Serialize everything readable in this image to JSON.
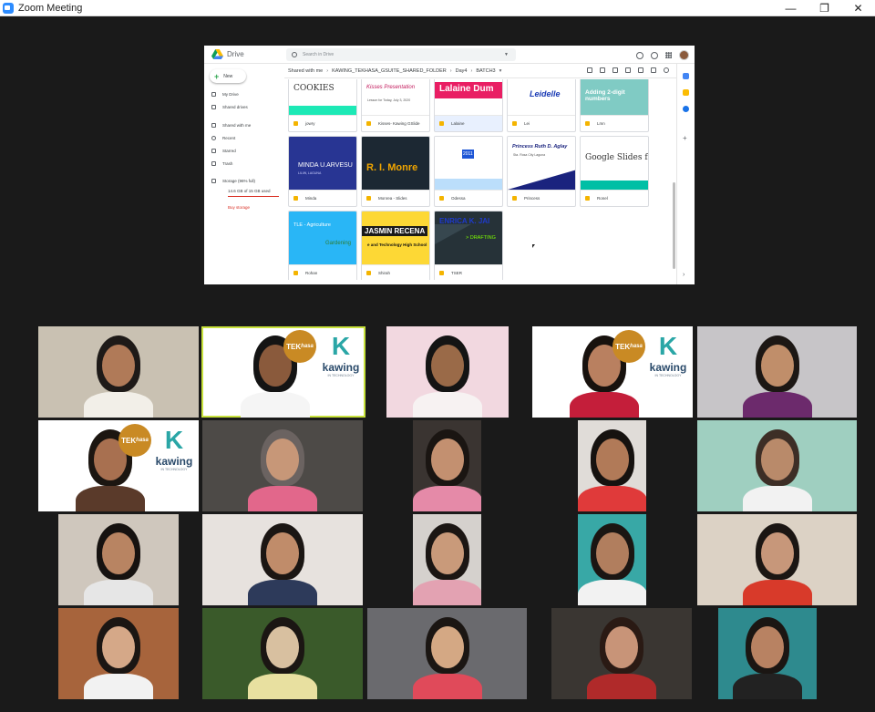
{
  "window": {
    "title": "Zoom Meeting",
    "controls": {
      "minimize": "—",
      "restore": "❐",
      "close": "✕"
    }
  },
  "drive": {
    "app_name": "Drive",
    "search_placeholder": "Search in Drive",
    "new_label": "New",
    "sidebar": [
      {
        "label": "My Drive",
        "icon": "my-drive-icon"
      },
      {
        "label": "Shared drives",
        "icon": "shared-drives-icon"
      },
      {
        "label": "Shared with me",
        "icon": "shared-with-me-icon"
      },
      {
        "label": "Recent",
        "icon": "clock-icon"
      },
      {
        "label": "Starred",
        "icon": "star-icon"
      },
      {
        "label": "Trash",
        "icon": "trash-icon"
      },
      {
        "label": "Storage (96% full)",
        "icon": "storage-icon"
      }
    ],
    "storage_used": "14.6 GB of 15 GB used",
    "storage_fraction": 0.96,
    "buy_storage": "Buy storage",
    "breadcrumb": [
      "Shared with me",
      "KAWING_TEKHASA_GSUITE_SHARED_FOLDER",
      "Day4",
      "BATCH3"
    ],
    "files": [
      {
        "name": "jowry",
        "thumb_text": "COOKIES",
        "thumb_bg": "#ffffff",
        "thumb_fg": "#333333",
        "band": "#1de9b6"
      },
      {
        "name": "Kisses- Kawing GSlide",
        "thumb_text": "Kisses Presentation",
        "thumb_sub": "Lesson for Today, July 3, 2020",
        "thumb_bg": "#ffffff",
        "thumb_fg": "#c2185b"
      },
      {
        "name": "Lalaine",
        "thumb_text": "Lalaine Dum",
        "thumb_bg": "#ffffff",
        "thumb_fg": "#ffffff",
        "band": "#e91e63"
      },
      {
        "name": "Lei",
        "thumb_text": "Leidelle",
        "thumb_bg": "#ffffff",
        "thumb_fg": "#1a3bb5"
      },
      {
        "name": "Lmn",
        "thumb_text": "Adding 2-digit numbers",
        "thumb_bg": "#80cbc4",
        "thumb_fg": "#ffffff"
      },
      {
        "name": "Minda",
        "thumb_text": "MINDA U.ARVESU",
        "thumb_sub": "LILIW, LAGUNA",
        "thumb_bg": "#283593",
        "thumb_fg": "#ffffff"
      },
      {
        "name": "Monrea - Slides",
        "thumb_text": "R. I. Monre",
        "thumb_bg": "#1c2833",
        "thumb_fg": "#f0a500"
      },
      {
        "name": "Odessa",
        "thumb_text": "2011",
        "thumb_sub": "DAY 3ARLY UPDATE",
        "thumb_bg": "#ffffff",
        "thumb_fg": "#1e56d6"
      },
      {
        "name": "Princess",
        "thumb_text": "Princess Ruth D. Aglay",
        "thumb_sub": "Sta. Rosa City Laguna",
        "thumb_bg": "#ffffff",
        "thumb_fg": "#1a237e"
      },
      {
        "name": "Ronel",
        "thumb_text": "Google Slides for E",
        "thumb_bg": "#ffffff",
        "thumb_fg": "#333333",
        "band": "#00bfa5"
      },
      {
        "name": "Rohan",
        "thumb_text": "TLE - Agriculture",
        "thumb_sub": "Gardening",
        "thumb_bg": "#29b6f6",
        "thumb_fg": "#ffffff"
      },
      {
        "name": "Shirah",
        "thumb_text": "JASMIN RECENA",
        "thumb_sub": "e and Technology High School",
        "thumb_bg": "#fdd835",
        "thumb_fg": "#ffffff"
      },
      {
        "name": "TSER",
        "thumb_text": "ENRICA K. JAI",
        "thumb_sub": "> DRAFTING",
        "thumb_bg": "#263238",
        "thumb_fg": "#1e3acb"
      }
    ]
  },
  "brand": {
    "tek": "TEK",
    "hasa": "hasa",
    "kawing": "kawing",
    "kawing_sub": "IN TECHNOLOGY"
  },
  "participants": [
    {
      "bg": "#c9c1b2",
      "skin": "#b07a58",
      "hair": "#1e1a18",
      "shirt": "#f2efe8"
    },
    {
      "bg": "#ffffff",
      "skin": "#8a5a3c",
      "hair": "#141414",
      "shirt": "#f5f5f5",
      "branded": true,
      "active": true
    },
    {
      "bg": "#f2d8e0",
      "skin": "#9a6a48",
      "hair": "#141414",
      "shirt": "#f7f2f2"
    },
    {
      "bg": "#ffffff",
      "skin": "#b98060",
      "hair": "#18120e",
      "shirt": "#c41e3a",
      "branded": true
    },
    {
      "bg": "#c7c5c8",
      "skin": "#c08e6a",
      "hair": "#1c1714",
      "shirt": "#6c2a6c"
    },
    {
      "bg": "#ffffff",
      "skin": "#a87050",
      "hair": "#1c1611",
      "shirt": "#5a3a2a",
      "branded": true
    },
    {
      "bg": "#4d4a47",
      "skin": "#c79778",
      "hair": "#6b6361",
      "shirt": "#e2678b"
    },
    {
      "bg": "#3a3431",
      "skin": "#c39070",
      "hair": "#1a1512",
      "shirt": "#e58aa8"
    },
    {
      "bg": "#e0dcd8",
      "skin": "#b17a58",
      "hair": "#161210",
      "shirt": "#e03a3a"
    },
    {
      "bg": "#9fcfc0",
      "skin": "#b98a6a",
      "hair": "#3d2e26",
      "shirt": "#f2f2f2"
    },
    {
      "bg": "#cfc7bd",
      "skin": "#b88462",
      "hair": "#161210",
      "shirt": "#e6e6e6"
    },
    {
      "bg": "#e7e2de",
      "skin": "#c08c6a",
      "hair": "#1b1613",
      "shirt": "#2d3a5a"
    },
    {
      "bg": "#d5d1cd",
      "skin": "#c99a7a",
      "hair": "#1b1613",
      "shirt": "#e3a2b2"
    },
    {
      "bg": "#38a8a6",
      "skin": "#b17e5e",
      "hair": "#1b1613",
      "shirt": "#f2f2f2"
    },
    {
      "bg": "#dcd2c5",
      "skin": "#c7977a",
      "hair": "#1b1613",
      "shirt": "#d83a2a"
    },
    {
      "bg": "#a7643c",
      "skin": "#d5a888",
      "hair": "#1b1613",
      "shirt": "#f2f2f2"
    },
    {
      "bg": "#3a5a2a",
      "skin": "#d8c0a0",
      "hair": "#1b1613",
      "shirt": "#e8e0a0"
    },
    {
      "bg": "#6a6a6e",
      "skin": "#d4a884",
      "hair": "#1b1613",
      "shirt": "#e04a5a"
    },
    {
      "bg": "#3a3632",
      "skin": "#c89478",
      "hair": "#2a1a14",
      "shirt": "#b02a2a"
    },
    {
      "bg": "#2e8a8e",
      "skin": "#b88262",
      "hair": "#1b1613",
      "shirt": "#222222"
    }
  ]
}
